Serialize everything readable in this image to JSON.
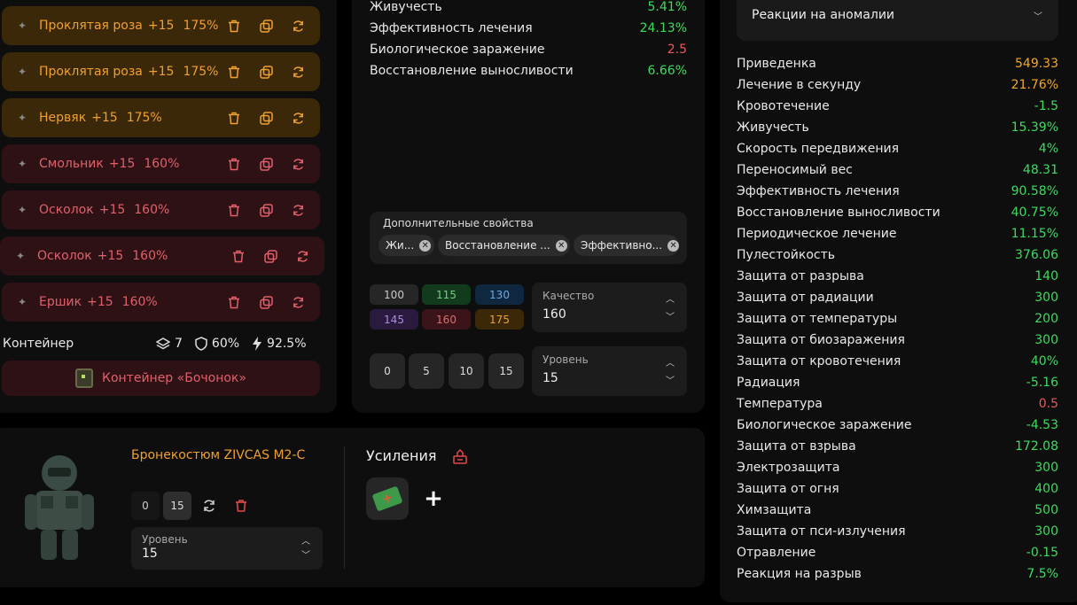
{
  "artifacts": [
    {
      "name": "Проклятая роза",
      "level": "+15",
      "quality": "175%",
      "tier": "orange",
      "icon": "rose-icon"
    },
    {
      "name": "Проклятая роза",
      "level": "+15",
      "quality": "175%",
      "tier": "orange",
      "icon": "rose-icon"
    },
    {
      "name": "Нервяк",
      "level": "+15",
      "quality": "175%",
      "tier": "orange",
      "icon": "nerve-icon"
    },
    {
      "name": "Смольник",
      "level": "+15",
      "quality": "160%",
      "tier": "red",
      "icon": "resin-icon"
    },
    {
      "name": "Осколок",
      "level": "+15",
      "quality": "160%",
      "tier": "red",
      "icon": "shard-icon"
    },
    {
      "name": "Осколок",
      "level": "+15",
      "quality": "160%",
      "tier": "red",
      "icon": "shard-icon"
    },
    {
      "name": "Ершик",
      "level": "+15",
      "quality": "160%",
      "tier": "red",
      "icon": "urchin-icon"
    }
  ],
  "container": {
    "label": "Контейнер",
    "slots": "7",
    "protection": "60%",
    "efficiency": "92.5%",
    "name": "Контейнер «Бочонок»"
  },
  "mid_stats": [
    {
      "label": "Живучесть",
      "value": "5.41%",
      "color": "green"
    },
    {
      "label": "Эффективность лечения",
      "value": "24.13%",
      "color": "green"
    },
    {
      "label": "Биологическое заражение",
      "value": "2.5",
      "color": "red"
    },
    {
      "label": "Восстановление выносливости",
      "value": "6.66%",
      "color": "green"
    }
  ],
  "extra_props": {
    "title": "Дополнительные свойства",
    "chips": [
      "Жи...",
      "Восстановление ...",
      "Эффективно..."
    ]
  },
  "quality_buttons": [
    {
      "label": "100",
      "bg": "#262626",
      "fg": "#cccccc"
    },
    {
      "label": "115",
      "bg": "#123a1c",
      "fg": "#6fd07f"
    },
    {
      "label": "130",
      "bg": "#0f2840",
      "fg": "#6fa8e0"
    },
    {
      "label": "145",
      "bg": "#2a1a3e",
      "fg": "#b08ae0"
    },
    {
      "label": "160",
      "bg": "#3a1418",
      "fg": "#e06a6a"
    },
    {
      "label": "175",
      "bg": "#3a2808",
      "fg": "#f0a030"
    }
  ],
  "quality_select": {
    "label": "Качество",
    "value": "160"
  },
  "level_buttons": [
    "0",
    "5",
    "10",
    "15"
  ],
  "level_select": {
    "label": "Уровень",
    "value": "15"
  },
  "armor": {
    "name": "Бронекостюм ZIVCAS M2-C",
    "level_buttons": [
      "0",
      "15"
    ],
    "level_label": "Уровень",
    "level_value": "15",
    "boosts_title": "Усиления"
  },
  "anomaly_select": "Реакции на аномалии",
  "right_stats": [
    {
      "label": "Приведенка",
      "value": "549.33",
      "color": "orange"
    },
    {
      "label": "Лечение в секунду",
      "value": "21.76%",
      "color": "orange"
    },
    {
      "label": "Кровотечение",
      "value": "-1.5",
      "color": "green"
    },
    {
      "label": "Живучесть",
      "value": "15.39%",
      "color": "green"
    },
    {
      "label": "Скорость передвижения",
      "value": "4%",
      "color": "green"
    },
    {
      "label": "Переносимый вес",
      "value": "48.31",
      "color": "green"
    },
    {
      "label": "Эффективность лечения",
      "value": "90.58%",
      "color": "green"
    },
    {
      "label": "Восстановление выносливости",
      "value": "40.75%",
      "color": "green"
    },
    {
      "label": "Периодическое лечение",
      "value": "11.15%",
      "color": "green"
    },
    {
      "label": "Пулестойкость",
      "value": "376.06",
      "color": "green"
    },
    {
      "label": "Защита от разрыва",
      "value": "140",
      "color": "green"
    },
    {
      "label": "Защита от радиации",
      "value": "300",
      "color": "green"
    },
    {
      "label": "Защита от температуры",
      "value": "200",
      "color": "green"
    },
    {
      "label": "Защита от биозаражения",
      "value": "300",
      "color": "green"
    },
    {
      "label": "Защита от кровотечения",
      "value": "40%",
      "color": "green"
    },
    {
      "label": "Радиация",
      "value": "-5.16",
      "color": "green"
    },
    {
      "label": "Температура",
      "value": "0.5",
      "color": "red"
    },
    {
      "label": "Биологическое заражение",
      "value": "-4.53",
      "color": "green"
    },
    {
      "label": "Защита от взрыва",
      "value": "172.08",
      "color": "green"
    },
    {
      "label": "Электрозащита",
      "value": "300",
      "color": "green"
    },
    {
      "label": "Защита от огня",
      "value": "400",
      "color": "green"
    },
    {
      "label": "Химзащита",
      "value": "500",
      "color": "green"
    },
    {
      "label": "Защита от пси-излучения",
      "value": "300",
      "color": "green"
    },
    {
      "label": "Отравление",
      "value": "-0.15",
      "color": "green"
    },
    {
      "label": "Реакция на разрыв",
      "value": "7.5%",
      "color": "green"
    }
  ]
}
